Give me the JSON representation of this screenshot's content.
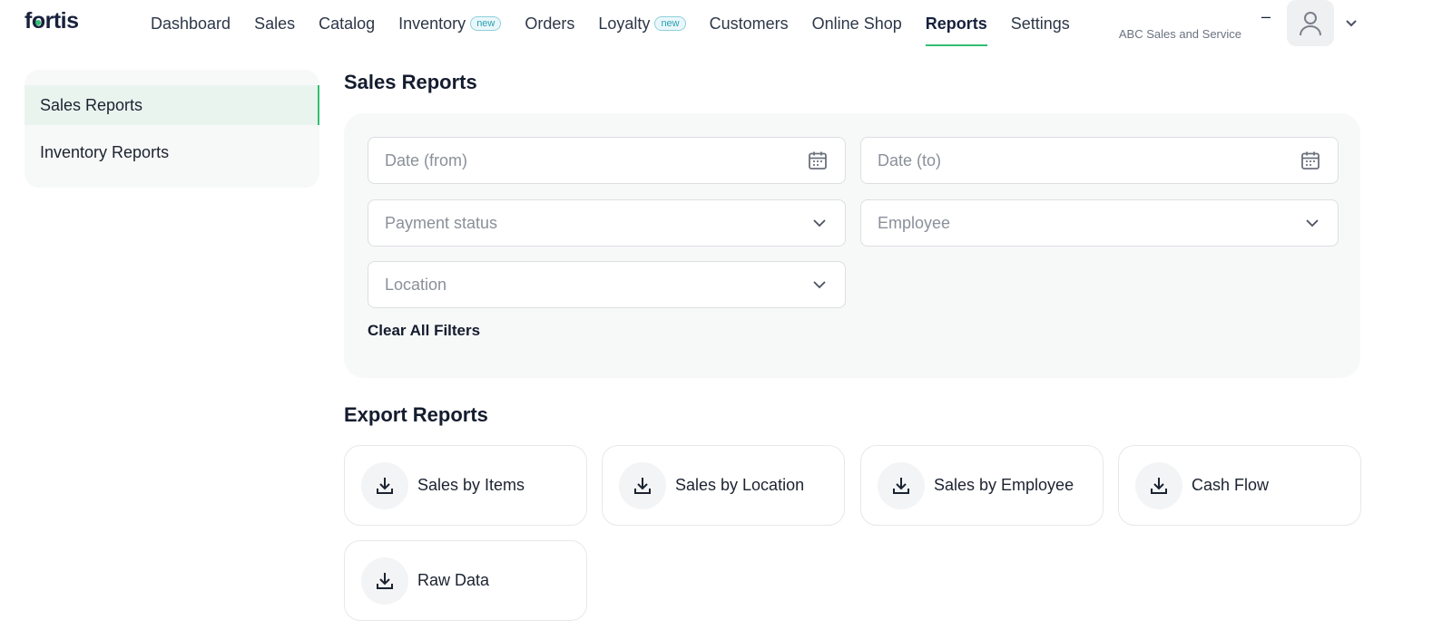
{
  "brand": {
    "logo_text": "fortis"
  },
  "nav": {
    "items": [
      {
        "label": "Dashboard"
      },
      {
        "label": "Sales"
      },
      {
        "label": "Catalog"
      },
      {
        "label": "Inventory",
        "badge": "new"
      },
      {
        "label": "Orders"
      },
      {
        "label": "Loyalty",
        "badge": "new"
      },
      {
        "label": "Customers"
      },
      {
        "label": "Online Shop"
      },
      {
        "label": "Reports",
        "active": true
      },
      {
        "label": "Settings"
      }
    ]
  },
  "account": {
    "dash": "–",
    "business_name": "ABC Sales and Service"
  },
  "sidebar": {
    "items": [
      {
        "label": "Sales Reports",
        "active": true
      },
      {
        "label": "Inventory Reports"
      }
    ]
  },
  "main": {
    "title": "Sales Reports",
    "filters": {
      "date_from": {
        "placeholder": "Date (from)",
        "icon": "calendar-icon"
      },
      "date_to": {
        "placeholder": "Date (to)",
        "icon": "calendar-icon"
      },
      "payment_status": {
        "placeholder": "Payment status",
        "icon": "chevron-down-icon"
      },
      "employee": {
        "placeholder": "Employee",
        "icon": "chevron-down-icon"
      },
      "location": {
        "placeholder": "Location",
        "icon": "chevron-down-icon"
      },
      "clear_label": "Clear All Filters"
    },
    "export_title": "Export Reports",
    "exports": [
      {
        "label": "Sales by Items",
        "icon": "download-icon"
      },
      {
        "label": "Sales by Location",
        "icon": "download-icon"
      },
      {
        "label": "Sales by Employee",
        "icon": "download-icon"
      },
      {
        "label": "Cash Flow",
        "icon": "download-icon"
      },
      {
        "label": "Raw Data",
        "icon": "download-icon"
      }
    ]
  },
  "colors": {
    "accent": "#2fbf71",
    "badge": "#2a9fb0",
    "text_dark": "#141c2e"
  }
}
